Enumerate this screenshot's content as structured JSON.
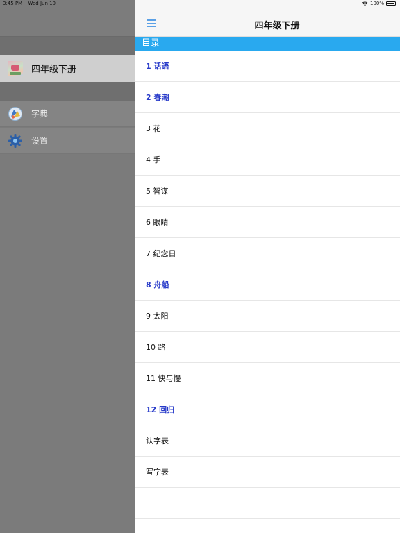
{
  "status_bar": {
    "time": "3:45 PM",
    "date": "Wed Jun 10",
    "battery": "100%"
  },
  "sidebar": {
    "book": {
      "title": "四年级下册",
      "thumb_icon": "book-cover-thumbnail"
    },
    "menu": [
      {
        "label": "字典",
        "icon": "dictionary-icon"
      },
      {
        "label": "设置",
        "icon": "settings-gear-icon"
      }
    ]
  },
  "panel": {
    "title": "四年级下册",
    "menu_icon": "hamburger-menu-icon",
    "section_title": "目录",
    "toc": [
      {
        "label": "1 话语",
        "highlighted": true
      },
      {
        "label": "2 春潮",
        "highlighted": true
      },
      {
        "label": "3 花",
        "highlighted": false
      },
      {
        "label": "4 手",
        "highlighted": false
      },
      {
        "label": "5 智谋",
        "highlighted": false
      },
      {
        "label": "6 眼睛",
        "highlighted": false
      },
      {
        "label": "7 纪念日",
        "highlighted": false
      },
      {
        "label": "8 舟船",
        "highlighted": true
      },
      {
        "label": "9 太阳",
        "highlighted": false
      },
      {
        "label": "10 路",
        "highlighted": false
      },
      {
        "label": "11 快与慢",
        "highlighted": false
      },
      {
        "label": "12 回归",
        "highlighted": true
      },
      {
        "label": "认字表",
        "highlighted": false
      },
      {
        "label": "写字表",
        "highlighted": false
      },
      {
        "label": "",
        "highlighted": false
      }
    ]
  },
  "colors": {
    "accent_blue": "#29a9ef",
    "highlight_text": "#2639c9",
    "overlay_gray": "#7b7b7b"
  }
}
